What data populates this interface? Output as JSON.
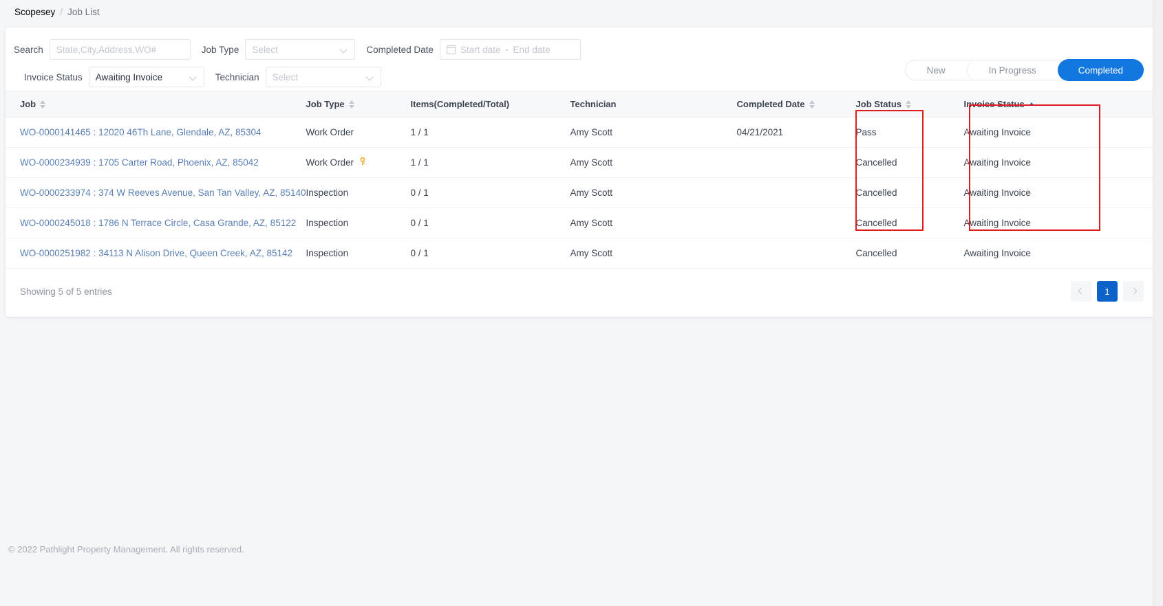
{
  "breadcrumb": {
    "root": "Scopesey",
    "separator": "/",
    "current": "Job List"
  },
  "filters": {
    "search_label": "Search",
    "search_value": "",
    "search_placeholder": "State,City,Address,WO#",
    "job_type_label": "Job Type",
    "job_type_value": "",
    "job_type_placeholder": "Select",
    "completed_date_label": "Completed Date",
    "start_date_placeholder": "Start date",
    "date_separator": "-",
    "end_date_placeholder": "End date",
    "invoice_status_label": "Invoice Status",
    "invoice_status_value": "Awaiting Invoice",
    "technician_label": "Technician",
    "technician_value": "",
    "technician_placeholder": "Select"
  },
  "status_tabs": {
    "items": [
      {
        "label": "New",
        "active": false
      },
      {
        "label": "In Progress",
        "active": false
      },
      {
        "label": "Completed",
        "active": true
      }
    ],
    "active_color": "#1377e0"
  },
  "table": {
    "columns": [
      {
        "label": "Job",
        "sortable": true,
        "sort": "none"
      },
      {
        "label": "Job Type",
        "sortable": true,
        "sort": "none"
      },
      {
        "label": "Items(Completed/Total)",
        "sortable": false,
        "sort": "none"
      },
      {
        "label": "Technician",
        "sortable": false,
        "sort": "none"
      },
      {
        "label": "Completed Date",
        "sortable": true,
        "sort": "none"
      },
      {
        "label": "Job Status",
        "sortable": true,
        "sort": "none"
      },
      {
        "label": "Invoice Status",
        "sortable": true,
        "sort": "asc"
      }
    ],
    "rows": [
      {
        "job": "WO-0000141465 : 12020 46Th Lane, Glendale, AZ, 85304",
        "job_type": "Work Order",
        "has_key_icon": false,
        "items": "1 / 1",
        "technician": "Amy Scott",
        "completed_date": "04/21/2021",
        "job_status": "Pass",
        "invoice_status": "Awaiting Invoice"
      },
      {
        "job": "WO-0000234939 : 1705 Carter Road, Phoenix, AZ, 85042",
        "job_type": "Work Order",
        "has_key_icon": true,
        "items": "1 / 1",
        "technician": "Amy Scott",
        "completed_date": "",
        "job_status": "Cancelled",
        "invoice_status": "Awaiting Invoice"
      },
      {
        "job": "WO-0000233974 : 374 W Reeves Avenue, San Tan Valley, AZ, 85140",
        "job_type": "Inspection",
        "has_key_icon": false,
        "items": "0 / 1",
        "technician": "Amy Scott",
        "completed_date": "",
        "job_status": "Cancelled",
        "invoice_status": "Awaiting Invoice"
      },
      {
        "job": "WO-0000245018 : 1786 N Terrace Circle, Casa Grande, AZ, 85122",
        "job_type": "Inspection",
        "has_key_icon": false,
        "items": "0 / 1",
        "technician": "Amy Scott",
        "completed_date": "",
        "job_status": "Cancelled",
        "invoice_status": "Awaiting Invoice"
      },
      {
        "job": "WO-0000251982 : 34113 N Alison Drive, Queen Creek, AZ, 85142",
        "job_type": "Inspection",
        "has_key_icon": false,
        "items": "0 / 1",
        "technician": "Amy Scott",
        "completed_date": "",
        "job_status": "Cancelled",
        "invoice_status": "Awaiting Invoice"
      }
    ]
  },
  "pagination": {
    "showing_text": "Showing 5 of 5 entries",
    "prev_label": "",
    "current_page": "1",
    "next_label": "",
    "active_color": "#0d62c9"
  },
  "annotations": {
    "highlight_color": "#e01b1b",
    "boxes": [
      {
        "name": "job-status-column",
        "label": ""
      },
      {
        "name": "invoice-status-column",
        "label": ""
      }
    ]
  },
  "footer": {
    "copyright": "© 2022 Pathlight Property Management. All rights reserved."
  },
  "icons": {
    "key": "⚷",
    "calendar": "calendar-icon",
    "chevron_down": "chevron-down-icon"
  }
}
